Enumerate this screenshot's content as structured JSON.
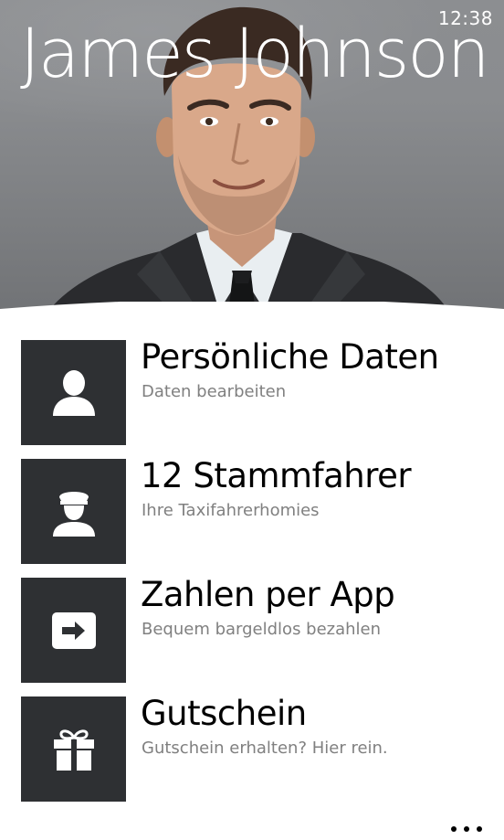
{
  "status_bar": {
    "time": "12:38"
  },
  "profile": {
    "name": "James Johnson"
  },
  "menu": {
    "items": [
      {
        "title": "Persönliche Daten",
        "subtitle": "Daten bearbeiten",
        "icon": "person-icon"
      },
      {
        "title": "12 Stammfahrer",
        "subtitle": "Ihre Taxifahrerhomies",
        "icon": "driver-icon"
      },
      {
        "title": "Zahlen per App",
        "subtitle": "Bequem bargeldlos bezahlen",
        "icon": "payment-arrow-icon"
      },
      {
        "title": "Gutschein",
        "subtitle": "Gutschein erhalten? Hier rein.",
        "icon": "gift-icon"
      }
    ]
  },
  "app_bar": {
    "more_icon": "more-dots-icon"
  },
  "colors": {
    "tile_background": "#2e3033",
    "subtitle_text": "#808080",
    "header_background": "#8a8c8f"
  }
}
